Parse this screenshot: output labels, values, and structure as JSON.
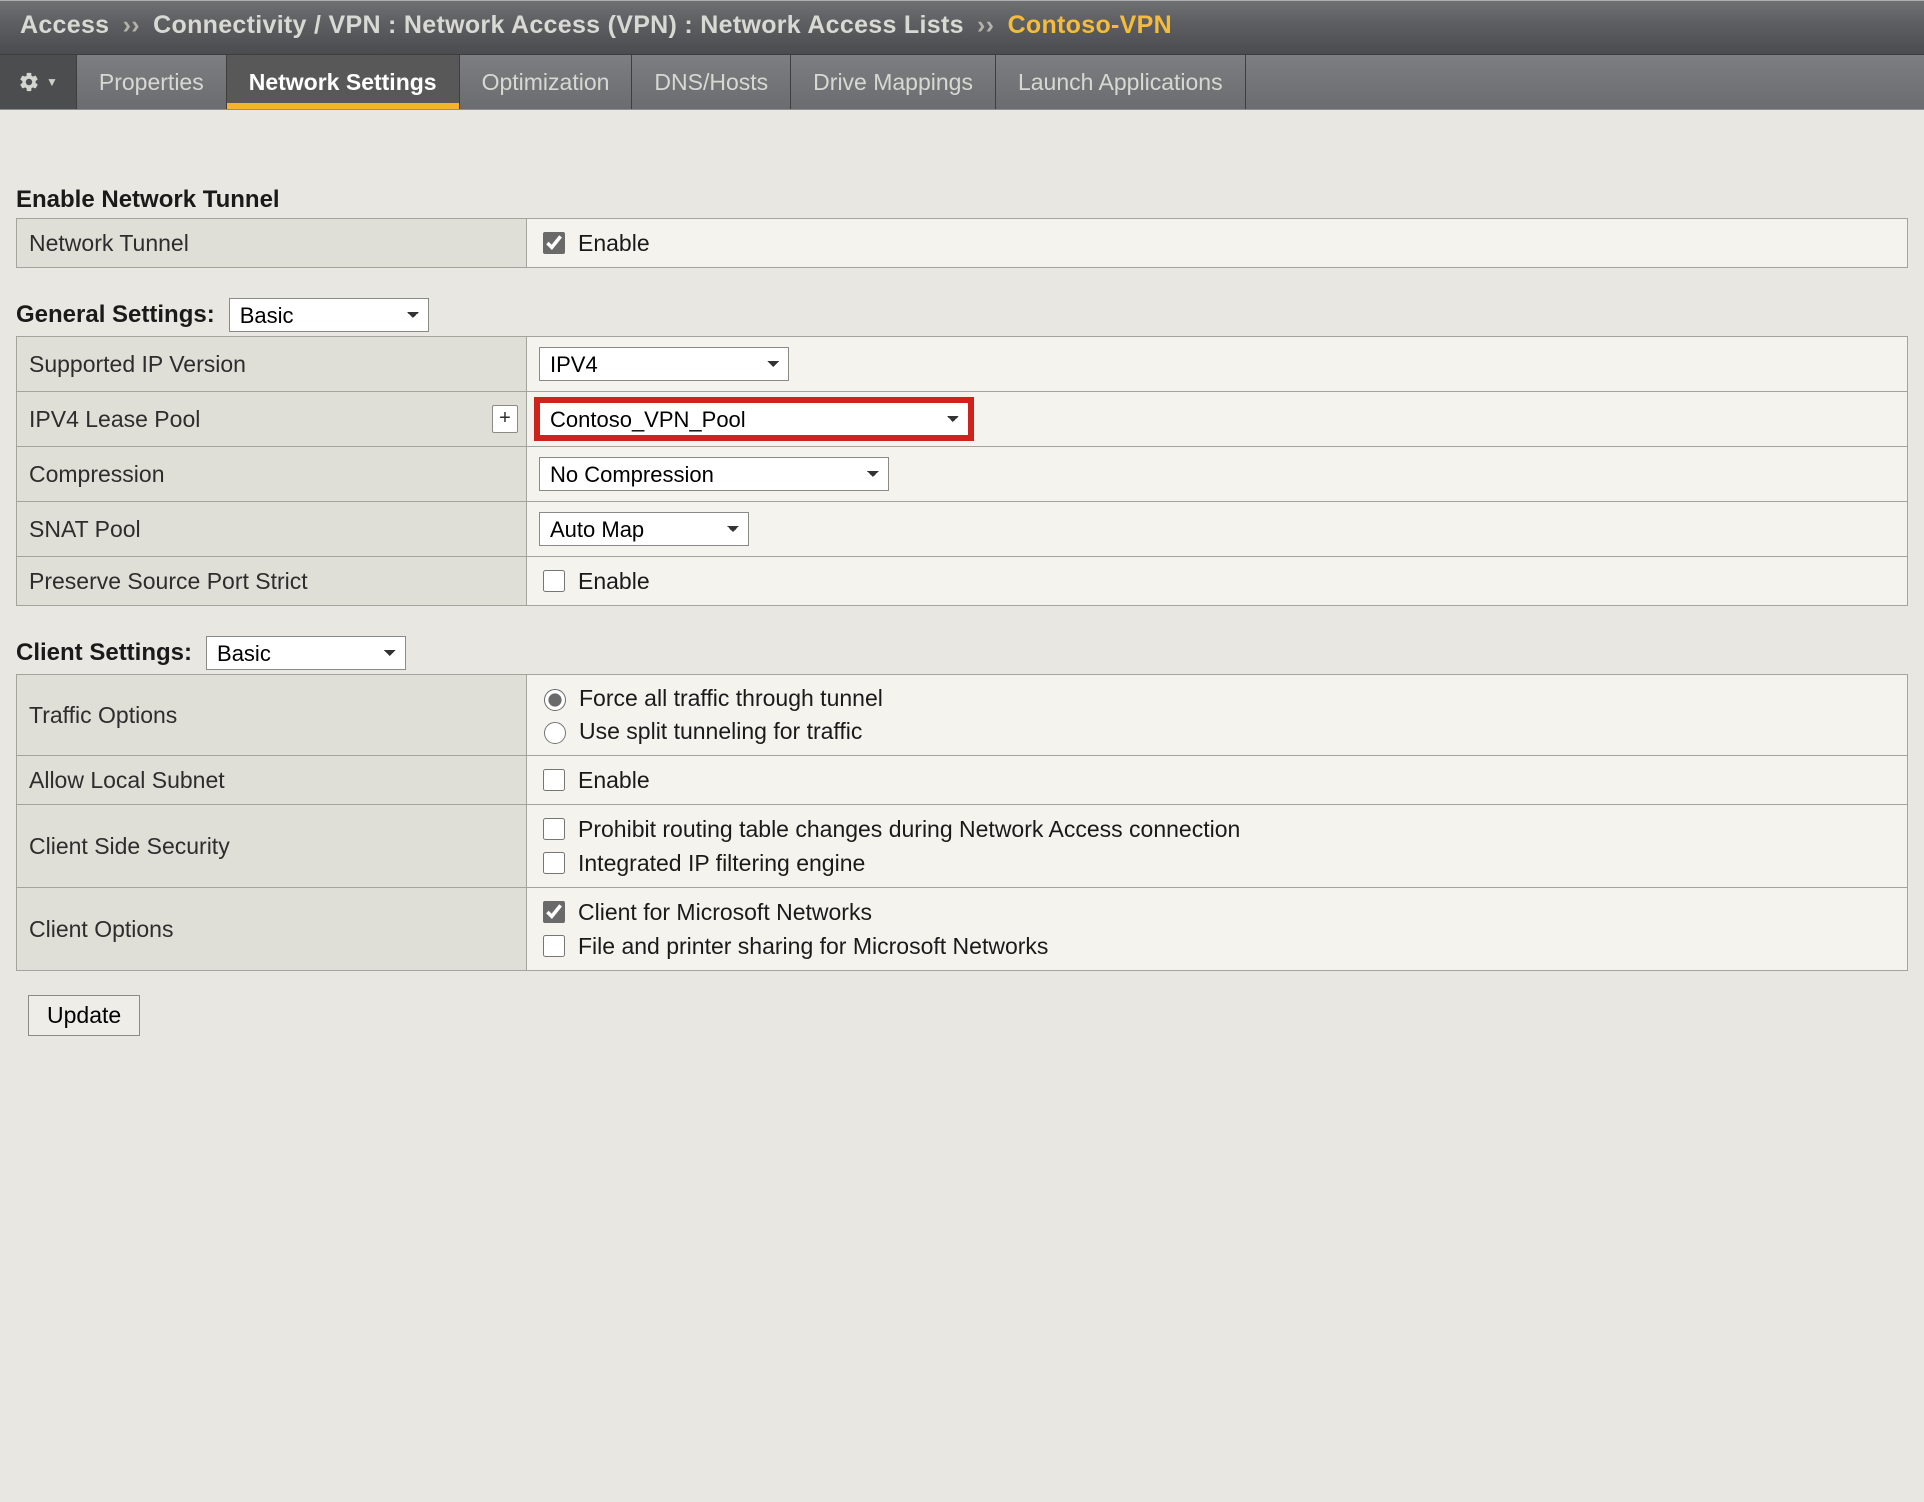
{
  "breadcrumb": {
    "root": "Access",
    "path": "Connectivity / VPN : Network Access (VPN) : Network Access Lists",
    "current": "Contoso-VPN",
    "sep": "››"
  },
  "tabs": {
    "items": [
      {
        "id": "properties",
        "label": "Properties"
      },
      {
        "id": "network-settings",
        "label": "Network Settings"
      },
      {
        "id": "optimization",
        "label": "Optimization"
      },
      {
        "id": "dns-hosts",
        "label": "DNS/Hosts"
      },
      {
        "id": "drive-mappings",
        "label": "Drive Mappings"
      },
      {
        "id": "launch-applications",
        "label": "Launch Applications"
      }
    ],
    "active": "network-settings"
  },
  "enable_tunnel": {
    "title": "Enable Network Tunnel",
    "row_label": "Network Tunnel",
    "enable_text": "Enable",
    "enabled": true
  },
  "general": {
    "title": "General Settings:",
    "level_select": "Basic",
    "rows": {
      "supported_ip_version": {
        "label": "Supported IP Version",
        "value": "IPV4"
      },
      "ipv4_lease_pool": {
        "label": "IPV4 Lease Pool",
        "value": "Contoso_VPN_Pool",
        "add_button": "+"
      },
      "compression": {
        "label": "Compression",
        "value": "No Compression"
      },
      "snat_pool": {
        "label": "SNAT Pool",
        "value": "Auto Map"
      },
      "preserve_src_port": {
        "label": "Preserve Source Port Strict",
        "enable_text": "Enable",
        "enabled": false
      }
    }
  },
  "client": {
    "title": "Client Settings:",
    "level_select": "Basic",
    "rows": {
      "traffic_options": {
        "label": "Traffic Options",
        "opts": [
          {
            "text": "Force all traffic through tunnel",
            "selected": true
          },
          {
            "text": "Use split tunneling for traffic",
            "selected": false
          }
        ]
      },
      "allow_local_subnet": {
        "label": "Allow Local Subnet",
        "enable_text": "Enable",
        "enabled": false
      },
      "client_side_security": {
        "label": "Client Side Security",
        "opts": [
          {
            "text": "Prohibit routing table changes during Network Access connection",
            "checked": false
          },
          {
            "text": "Integrated IP filtering engine",
            "checked": false
          }
        ]
      },
      "client_options": {
        "label": "Client Options",
        "opts": [
          {
            "text": "Client for Microsoft Networks",
            "checked": true
          },
          {
            "text": "File and printer sharing for Microsoft Networks",
            "checked": false
          }
        ]
      }
    }
  },
  "update_button": "Update"
}
